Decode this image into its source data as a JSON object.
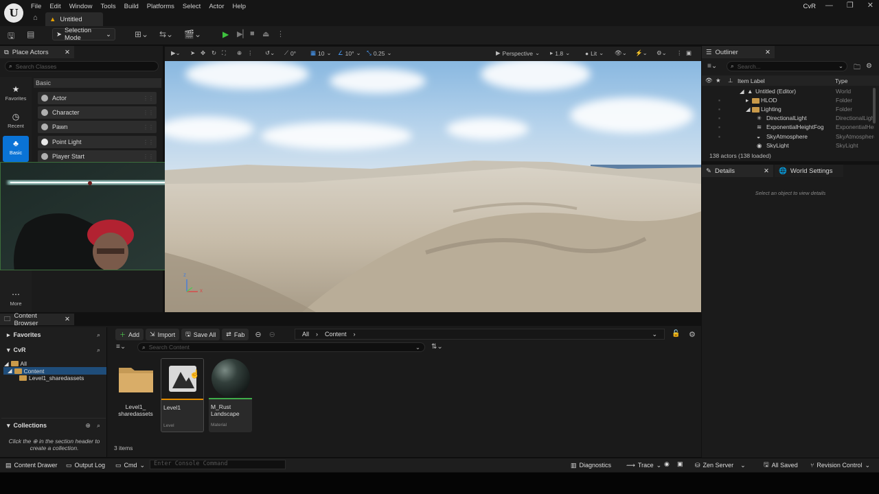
{
  "title_bar": {
    "logo": "U",
    "menu": [
      "File",
      "Edit",
      "Window",
      "Tools",
      "Build",
      "Platforms",
      "Select",
      "Actor",
      "Help"
    ],
    "doc_tab": "Untitled",
    "project": "CvR",
    "icons": {
      "home": "home-icon",
      "minimize": "minimize-icon",
      "maximize": "maximize-icon",
      "close": "close-icon"
    }
  },
  "toolbar": {
    "selection_mode": "Selection Mode",
    "play_icons": [
      "play-icon",
      "step-icon",
      "stop-icon",
      "eject-icon"
    ]
  },
  "place_actors": {
    "tab_label": "Place Actors",
    "search_placeholder": "Search Classes",
    "categories": [
      {
        "label": "Favorites",
        "icon": "star-icon"
      },
      {
        "label": "Recent",
        "icon": "clock-icon"
      },
      {
        "label": "Basic",
        "icon": "shapes-icon",
        "active": true
      },
      {
        "label": "More",
        "icon": "ellipsis-icon"
      }
    ],
    "section": "Basic",
    "items": [
      "Actor",
      "Character",
      "Pawn",
      "Point Light",
      "Player Start"
    ]
  },
  "viewport": {
    "values": {
      "rotation": "0°",
      "grid": "10",
      "angle": "10°",
      "scale": "0.25"
    },
    "perspective": "Perspective",
    "speed": "1.8",
    "view_mode": "Lit",
    "gizmo": {
      "z": "z",
      "x": "x"
    }
  },
  "outliner": {
    "tab_label": "Outliner",
    "search_placeholder": "Search...",
    "col_label": "Item Label",
    "col_type": "Type",
    "rows": [
      {
        "label": "Untitled (Editor)",
        "type": "World",
        "indent": 0
      },
      {
        "label": "HLOD",
        "type": "Folder",
        "indent": 1
      },
      {
        "label": "Lighting",
        "type": "Folder",
        "indent": 1
      },
      {
        "label": "DirectionalLight",
        "type": "DirectionalLight",
        "indent": 2
      },
      {
        "label": "ExponentialHeightFog",
        "type": "ExponentialHeightFog",
        "indent": 2
      },
      {
        "label": "SkyAtmosphere",
        "type": "SkyAtmosphere",
        "indent": 2
      },
      {
        "label": "SkyLight",
        "type": "SkyLight",
        "indent": 2
      }
    ],
    "actor_count": "138 actors (138 loaded)"
  },
  "details": {
    "tab_label": "Details",
    "world_settings_label": "World Settings",
    "hint": "Select an object to view details"
  },
  "content_browser": {
    "tab_label": "Content Browser",
    "favorites": "Favorites",
    "project": "CvR",
    "tree": {
      "all": "All",
      "content": "Content",
      "shared": "Level1_sharedassets"
    },
    "collections": "Collections",
    "collections_hint_a": "Click the",
    "collections_hint_b": "in the section header to",
    "collections_hint_c": "create a collection.",
    "buttons": {
      "add": "Add",
      "import": "Import",
      "save_all": "Save All",
      "fab": "Fab"
    },
    "path": [
      "All",
      "Content"
    ],
    "search_placeholder": "Search Content",
    "assets": [
      {
        "name_a": "Level1_",
        "name_b": "sharedassets",
        "kind": ""
      },
      {
        "name_a": "Level1",
        "name_b": "",
        "kind": "Level"
      },
      {
        "name_a": "M_Rust",
        "name_b": "Landscape",
        "kind": "Material"
      }
    ],
    "item_count": "3 items"
  },
  "status_bar": {
    "content_drawer": "Content Drawer",
    "output_log": "Output Log",
    "cmd": "Cmd",
    "console_placeholder": "Enter Console Command",
    "diagnostics": "Diagnostics",
    "trace": "Trace",
    "zen_server": "Zen Server",
    "all_saved": "All Saved",
    "revision_control": "Revision Control"
  }
}
